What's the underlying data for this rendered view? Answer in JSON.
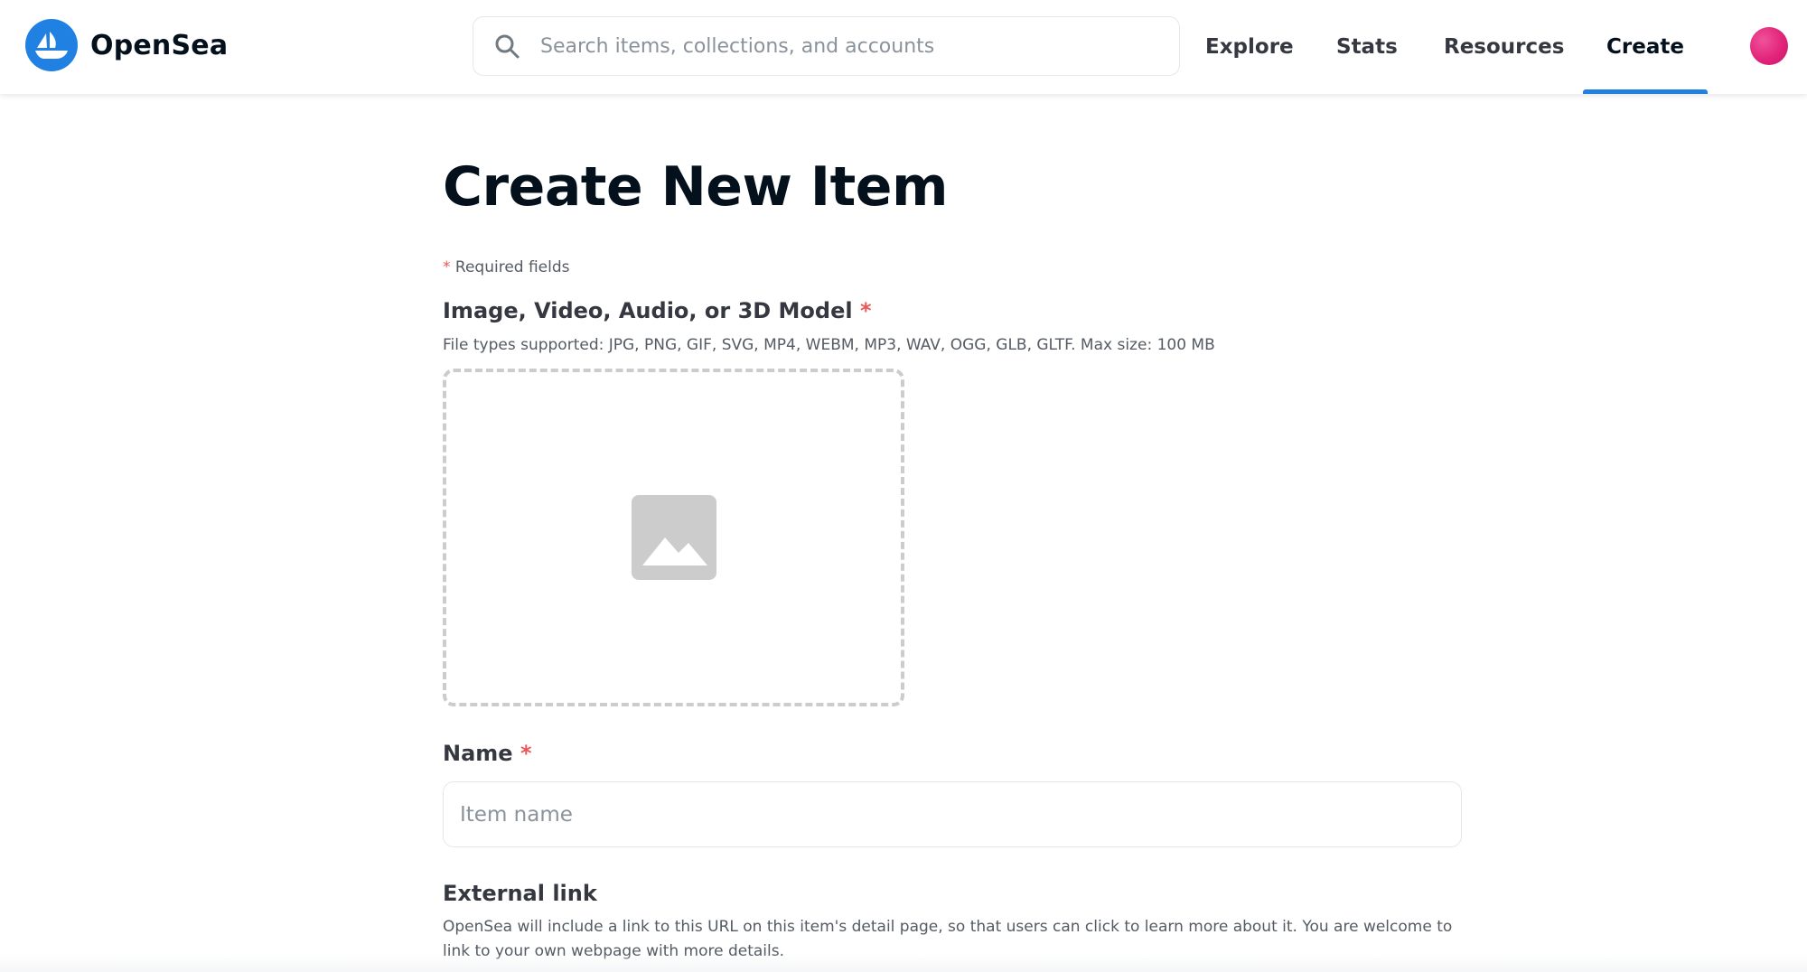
{
  "nav": {
    "brand": "OpenSea",
    "search_placeholder": "Search items, collections, and accounts",
    "links": {
      "explore": "Explore",
      "stats": "Stats",
      "resources": "Resources",
      "create": "Create"
    },
    "active_link": "Create"
  },
  "page": {
    "title": "Create New Item",
    "required_asterisk": "*",
    "required_note": "Required fields"
  },
  "form": {
    "media": {
      "label": "Image, Video, Audio, or 3D Model",
      "required_mark": "*",
      "help": "File types supported: JPG, PNG, GIF, SVG, MP4, WEBM, MP3, WAV, OGG, GLB, GLTF. Max size: 100 MB",
      "icon": "image-icon"
    },
    "name": {
      "label": "Name",
      "required_mark": "*",
      "placeholder": "Item name",
      "value": ""
    },
    "external_link": {
      "label": "External link",
      "help": "OpenSea will include a link to this URL on this item's detail page, so that users can click to learn more about it. You are welcome to link to your own webpage with more details."
    }
  },
  "colors": {
    "brand_blue": "#2081e2",
    "required_red": "#eb5757",
    "avatar_pink": "#e2247a"
  }
}
